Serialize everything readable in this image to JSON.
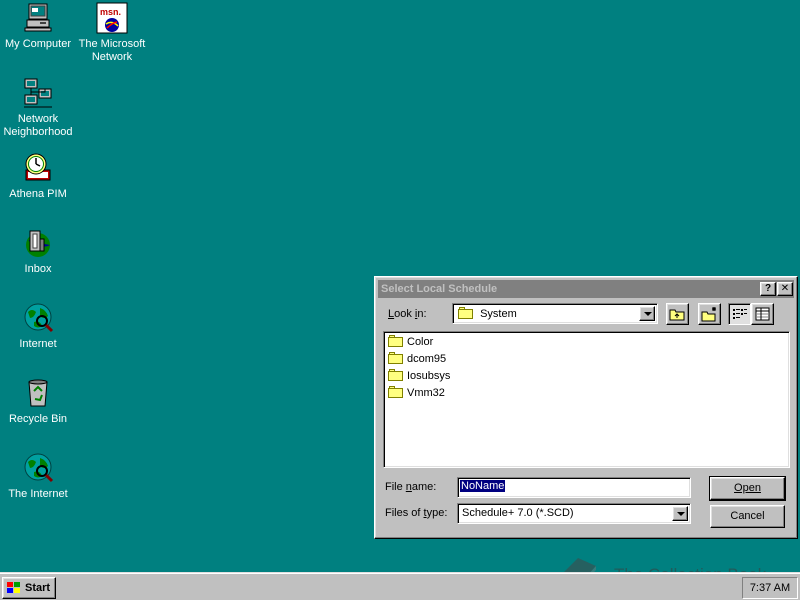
{
  "desktop": {
    "icons": [
      {
        "label": "My Computer"
      },
      {
        "label": "The Microsoft\nNetwork"
      },
      {
        "label": "Network\nNeighborhood"
      },
      {
        "label": "Athena PIM"
      },
      {
        "label": "Inbox"
      },
      {
        "label": "Internet"
      },
      {
        "label": "Recycle Bin"
      },
      {
        "label": "The Internet"
      }
    ],
    "msn_logo_text": "msn."
  },
  "dialog": {
    "title": "Select Local Schedule",
    "help_btn": "?",
    "close_btn": "✕",
    "look_in_label": "Look in:",
    "look_in_value": "System",
    "files": [
      "Color",
      "dcom95",
      "Iosubsys",
      "Vmm32"
    ],
    "file_name_label": "File name:",
    "file_name_value": "NoName",
    "files_of_type_label": "Files of type:",
    "files_of_type_value": "Schedule+ 7.0 (*.SCD)",
    "open_btn": "Open",
    "cancel_btn": "Cancel"
  },
  "taskbar": {
    "start_label": "Start",
    "clock": "7:37 AM"
  },
  "watermark": {
    "text": "The Collection Book"
  },
  "colors": {
    "desktop": "#008080",
    "face": "#c0c0c0",
    "inactive_title": "#808080",
    "selection": "#000080"
  }
}
